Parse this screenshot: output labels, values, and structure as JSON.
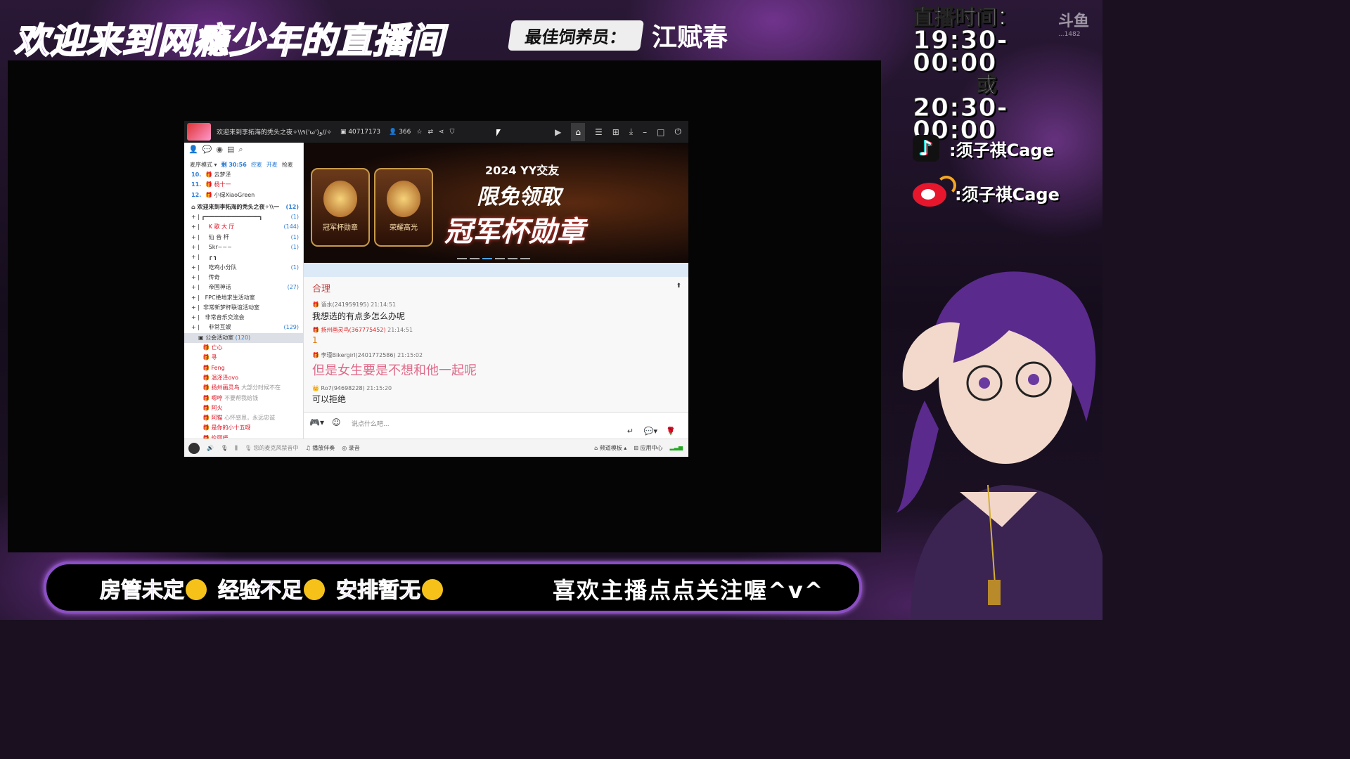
{
  "overlay": {
    "banner_title": "欢迎来到网瘾少年的直播间",
    "feeder_label": "最佳饲养员：",
    "feeder_name": "江赋春",
    "schedule": {
      "label": "直播时间：",
      "time1": "19:30-00:00",
      "or": "或",
      "time2": "20:30-00:00"
    },
    "watermark": "斗鱼",
    "watermark_sub": "...1482",
    "tiktok": ":须子祺Cage",
    "weibo": ":须子祺Cage",
    "bottom_left": [
      "房管未定",
      "经验不足",
      "安排暂无"
    ],
    "bottom_right": "喜欢主播点点关注喔^v^",
    "accent": "#8b4fc4"
  },
  "yy": {
    "title": "欢迎来到李拓海的秃头之夜✧\\\\٩('ω')و//✧",
    "room_id": "40717173",
    "online": "366",
    "mode": "麦序模式",
    "timer": "剩 30:56",
    "links": [
      "控麦",
      "开麦",
      "抢麦"
    ],
    "queue": [
      {
        "num": "10.",
        "name": "云梦泽"
      },
      {
        "num": "11.",
        "name": "杨十一"
      },
      {
        "num": "12.",
        "name": "小绿XiaoGreen"
      }
    ],
    "channel_root": {
      "name": "欢迎来到李拓海的秃头之夜✧\\\\一",
      "count": "(12)"
    },
    "channels": [
      {
        "name": "┏━━━━━━━━━━━━━━━━┓",
        "count": "(1)"
      },
      {
        "name": "K 歌 大 厅",
        "count": "(144)"
      },
      {
        "name": "仙 音 杆",
        "count": "(1)"
      },
      {
        "name": "Skr~~~",
        "count": "(1)"
      },
      {
        "name": "┏ ┓",
        "count": ""
      },
      {
        "name": "吃鸡小分队",
        "count": "(1)"
      },
      {
        "name": "传奇",
        "count": ""
      },
      {
        "name": "帝国神话",
        "count": "(27)"
      },
      {
        "name": "FPC绝地求生活动室",
        "count": ""
      },
      {
        "name": "非常新梦杯联谊活动室",
        "count": ""
      },
      {
        "name": "非常音乐交流会",
        "count": ""
      },
      {
        "name": "非常互娱",
        "count": "(129)"
      }
    ],
    "sub_channel": {
      "name": "公会活动室",
      "count": "(120)"
    },
    "members": [
      "亡心",
      "寻",
      "Feng",
      "温泽泽ovo",
      "扬州画灵鸟",
      "嗯哼",
      "阿火",
      "阿猫",
      "是你的小十五呀",
      "伦丽梧"
    ],
    "member_notes": {
      "扬州画灵鸟": "大部分时候不在",
      "嗯哼": "不要帮我给钱",
      "阿猫": "心怀感恩，永远忠诚"
    },
    "banner": {
      "sub": "2024 YY交友",
      "main": "限免领取",
      "big": "冠军杯勋章",
      "badge1": "冠军杯勋章",
      "badge2": "荣耀高光"
    },
    "chat_header": "合理",
    "messages": [
      {
        "user": "语水(241959195)",
        "time": "21:14:51",
        "text": "我想选的有点多怎么办呢",
        "style": ""
      },
      {
        "user": "扬州画灵鸟(367775452)",
        "time": "21:14:51",
        "text": "1",
        "style": "orange"
      },
      {
        "user": "李瑾Bikergirl(2401772586)",
        "time": "21:15:02",
        "text": "但是女生要是不想和他一起呢",
        "style": "pink"
      },
      {
        "user": "Ro7(94698228)",
        "time": "21:15:20",
        "text": "可以拒绝",
        "style": ""
      }
    ],
    "input_placeholder": "说点什么吧...",
    "footer": {
      "mic_status": "您的麦克风禁音中",
      "music": "播放伴奏",
      "record": "录音",
      "template": "频道模板",
      "apps": "应用中心"
    }
  }
}
